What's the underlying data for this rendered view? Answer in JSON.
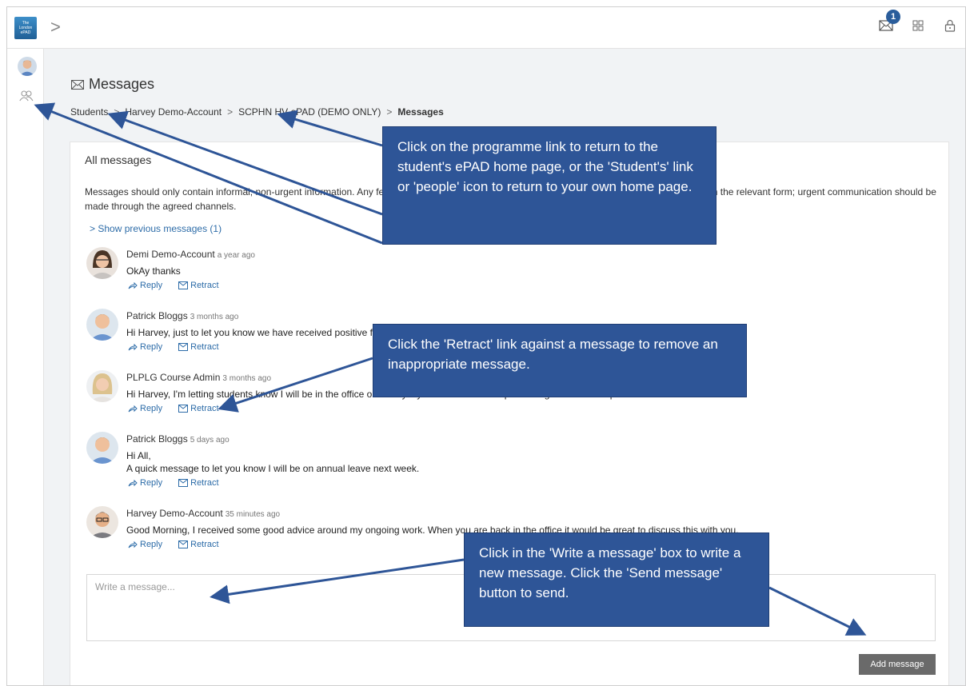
{
  "app": {
    "logo_text": "The London ePAD"
  },
  "topbar": {
    "chevron": ">",
    "messages_count": "1"
  },
  "page": {
    "title": "Messages",
    "breadcrumbs": [
      "Students",
      "Harvey Demo-Account",
      "SCPHN HV ePAD (DEMO ONLY)",
      "Messages"
    ],
    "separator": ">"
  },
  "card": {
    "title": "All messages",
    "notice": "Messages should only contain informal, non-urgent information. Any feedback regarding the student's performance or progress should be recorded in the relevant form; urgent communication should be made through the agreed channels.",
    "show_previous": "> Show previous messages (1)"
  },
  "actions": {
    "reply": "Reply",
    "retract": "Retract"
  },
  "messages": [
    {
      "name": "Demi Demo-Account",
      "time": "a year ago",
      "lines": [
        "OkAy thanks"
      ]
    },
    {
      "name": "Patrick Bloggs",
      "time": "3 months ago",
      "lines": [
        "Hi Harvey, just to let you know we have received positive feedback from your practice assessor."
      ]
    },
    {
      "name": "PLPLG Course Admin",
      "time": "3 months ago",
      "lines": [
        "Hi Harvey, I'm letting students know I will be in the office on Friday if you would like to drop in for a general catch up."
      ]
    },
    {
      "name": "Patrick Bloggs",
      "time": "5 days ago",
      "lines": [
        "Hi All,",
        "A quick message to let you know I will be on annual leave next week."
      ]
    },
    {
      "name": "Harvey Demo-Account",
      "time": "35 minutes ago",
      "lines": [
        "Good Morning, I received some good advice around my ongoing work. When you are back in the office it would be great to discuss this with you."
      ]
    }
  ],
  "compose": {
    "placeholder": "Write a message..."
  },
  "add_button": "Add message",
  "callouts": {
    "programme": "Click on the programme link to return to the student's ePAD home page, or the 'Student's' link or 'people' icon to return to your own home page.",
    "retract": "Click the 'Retract' link against a message to remove an inappropriate message.",
    "write": "Click in the 'Write a message' box to write a new message. Click the 'Send message' button to send."
  },
  "colors": {
    "callout": "#2e5597",
    "link": "#2d6ca8",
    "badge": "#2a5d9b",
    "button": "#6a6a6a"
  }
}
